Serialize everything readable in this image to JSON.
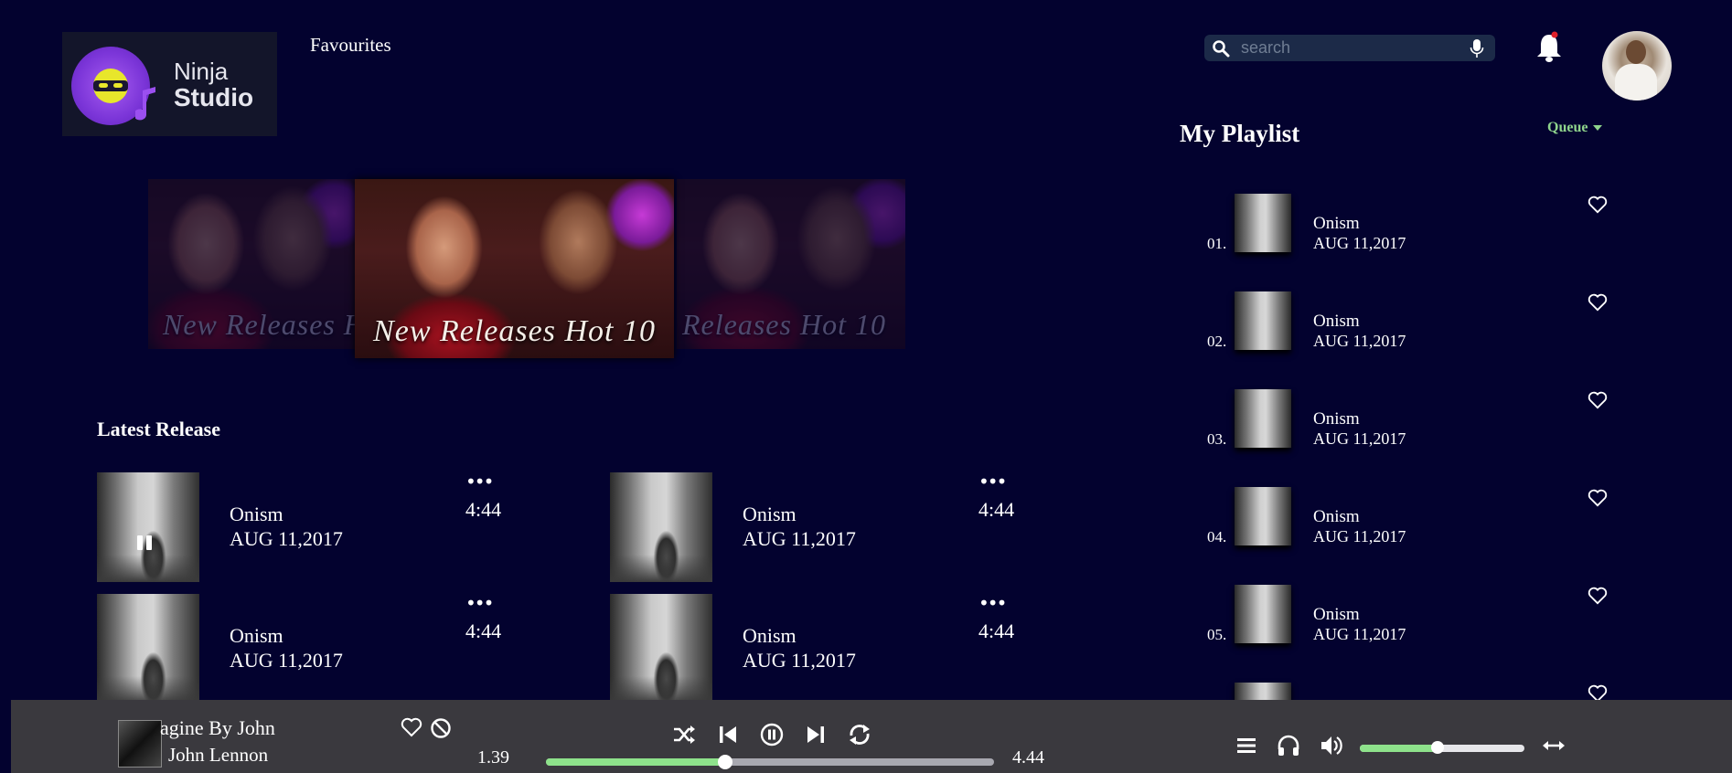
{
  "header": {
    "logo": {
      "line1": "Ninja",
      "line2": "Studio"
    },
    "nav": {
      "favourites": "Favourites"
    },
    "search": {
      "placeholder": "search",
      "value": ""
    },
    "icons": {
      "search": "search-icon",
      "mic": "mic-icon",
      "bell": "bell-icon",
      "avatar": "avatar"
    },
    "notification_dot_color": "#e0202a"
  },
  "banner": {
    "slides": [
      {
        "title": "New Releases Hot 10"
      },
      {
        "title": "New Releases Hot 10"
      },
      {
        "title": "New Releases Hot 10"
      }
    ],
    "side_left_text": "New Releases H",
    "side_right_text": "Releases Hot 10"
  },
  "latest": {
    "title": "Latest Release",
    "cards": [
      {
        "title": "Onism",
        "date": "AUG 11,2017",
        "duration": "4:44",
        "more": "•••",
        "playing": true
      },
      {
        "title": "Onism",
        "date": "AUG 11,2017",
        "duration": "4:44",
        "more": "•••",
        "playing": false
      },
      {
        "title": "Onism",
        "date": "AUG 11,2017",
        "duration": "4:44",
        "more": "•••",
        "playing": false
      },
      {
        "title": "Onism",
        "date": "AUG 11,2017",
        "duration": "4:44",
        "more": "•••",
        "playing": false
      }
    ]
  },
  "playlist": {
    "title": "My Playlist",
    "queue_label": "Queue",
    "items": [
      {
        "num": "01.",
        "title": "Onism",
        "date": "AUG 11,2017"
      },
      {
        "num": "02.",
        "title": "Onism",
        "date": "AUG 11,2017"
      },
      {
        "num": "03.",
        "title": "Onism",
        "date": "AUG 11,2017"
      },
      {
        "num": "04.",
        "title": "Onism",
        "date": "AUG 11,2017"
      },
      {
        "num": "05.",
        "title": "Onism",
        "date": "AUG 11,2017"
      },
      {
        "num": "",
        "title": "",
        "date": ""
      }
    ]
  },
  "player": {
    "now_playing": {
      "title": "agine By John",
      "artist": "John Lennon"
    },
    "elapsed": "1.39",
    "total": "4.44",
    "progress_fraction": 0.4,
    "volume_fraction": 0.47,
    "controls": [
      "shuffle-icon",
      "previous-icon",
      "pause-icon",
      "next-icon",
      "repeat-icon"
    ],
    "right_controls": [
      "menu-icon",
      "headphones-icon",
      "volume-icon",
      "expand-icon"
    ],
    "accent_color": "#8ee28b"
  }
}
